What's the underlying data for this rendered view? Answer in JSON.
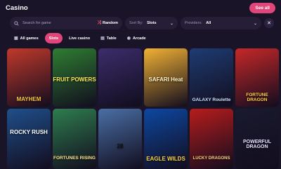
{
  "header": {
    "title": "Casino",
    "see_all": "See all"
  },
  "filters": {
    "search_placeholder": "Search for game",
    "random_label": "Random",
    "sort_label": "Sort By:",
    "sort_value": "Slots",
    "providers_label": "Providers:",
    "providers_value": "All"
  },
  "categories": [
    {
      "label": "All games",
      "icon": "grid-icon",
      "active": false
    },
    {
      "label": "Slots",
      "icon": "",
      "active": true
    },
    {
      "label": "Live casino",
      "icon": "",
      "active": false
    },
    {
      "label": "Table",
      "icon": "cards-icon",
      "active": false
    },
    {
      "label": "Arcade",
      "icon": "gamepad-icon",
      "active": false
    }
  ],
  "games_row1": [
    {
      "caption": "MAYHEM",
      "color": "#c0392b"
    },
    {
      "caption": "FRUIT POWERS",
      "color": "#2e7d32"
    },
    {
      "caption": "",
      "color": "#3b2d6b"
    },
    {
      "caption": "SAFARI Heat",
      "color": "#f2b134"
    },
    {
      "caption": "GALAXY Roulette",
      "color": "#1e3c72"
    },
    {
      "caption": "FORTUNE DRAGON",
      "color": "#c62828"
    }
  ],
  "games_row2": [
    {
      "caption": "ROCKY RUSH",
      "color": "#1f4f8b"
    },
    {
      "caption": "FORTUNES RISING",
      "color": "#2e7d4f"
    },
    {
      "caption": "28",
      "color": "#4a6fa5"
    },
    {
      "caption": "EAGLE WILDS",
      "color": "#0d47a1"
    },
    {
      "caption": "LUCKY DRAGONS",
      "color": "#b71c1c"
    },
    {
      "caption": "POWERFUL DRAGON",
      "color": "#1a1a2e"
    }
  ]
}
